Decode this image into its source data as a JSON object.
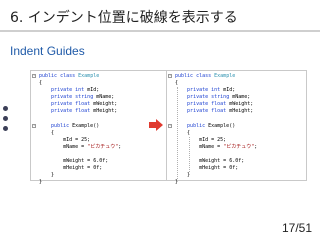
{
  "slide": {
    "title": "6. インデント位置に破線を表示する",
    "subtitle": "Indent Guides",
    "page_number": "17/51"
  },
  "code": {
    "lines": [
      "public class Example",
      "{",
      "    private int mId;",
      "    private string mName;",
      "    private float mWeight;",
      "    private float mHeight;",
      "",
      "    public Example()",
      "    {",
      "        mId = 25;",
      "        mName = \"ピカチュウ\";",
      "",
      "        mWeight = 6.0f;",
      "        mHeight = 0f;",
      "    }",
      "}"
    ]
  },
  "colors": {
    "keyword": "#1a3fd1",
    "type": "#2b91af",
    "string": "#a31515",
    "subtitle": "#1f5aa8",
    "arrow": "#e03a2f"
  },
  "icons": {
    "arrow": "right-arrow-icon",
    "fold": "fold-toggle-icon"
  }
}
